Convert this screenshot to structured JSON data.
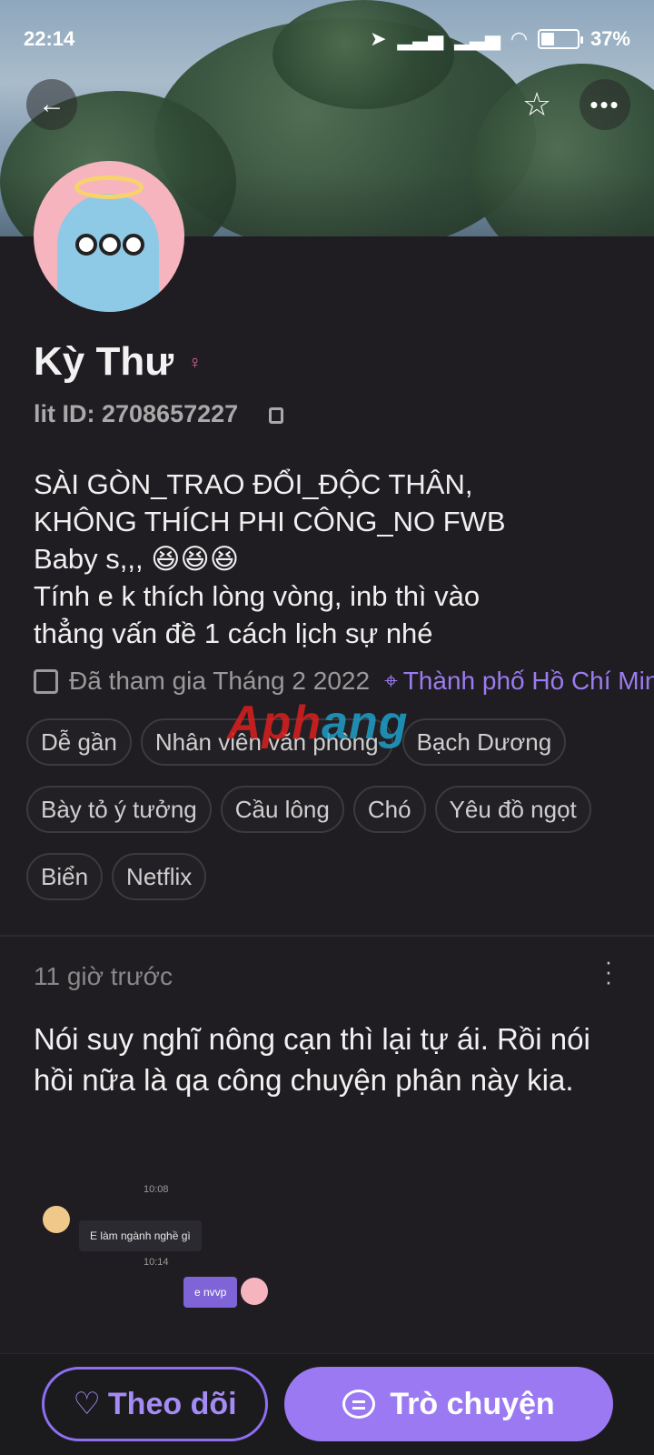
{
  "status_bar": {
    "time": "22:14",
    "battery": "37%"
  },
  "profile": {
    "name": "Kỳ Thư",
    "lit_id": "lit ID: 2708657227",
    "bio": [
      "SÀI GÒN_TRAO ĐỔI_ĐỘC THÂN,",
      "KHÔNG THÍCH PHI CÔNG_NO FWB",
      "Baby s,,, 😆😆😆",
      "Tính e k thích lòng vòng, inb thì vào",
      "thẳng vấn đề 1 cách lịch sự nhé"
    ],
    "joined": "Đã tham gia Tháng 2 2022",
    "location": "Thành phố Hồ Chí Minh",
    "tags": [
      "Dễ gần",
      "Nhân viên văn phòng",
      "Bạch Dương",
      "Bày tỏ ý tưởng",
      "Cầu lông",
      "Chó",
      "Yêu đồ ngọt",
      "Biển",
      "Netflix"
    ]
  },
  "watermark": {
    "part1": "Aph",
    "part2": "ang"
  },
  "post": {
    "time": "11 giờ trước",
    "text": "Nói suy nghĩ nông cạn thì lại tự ái. Rồi nói hồi nữa là qa công chuyện phân này kia.",
    "chat": {
      "ts1": "10:08",
      "msg_in": "E làm ngành nghề gì",
      "ts2": "10:14",
      "msg_out": "e nvvp"
    }
  },
  "actions": {
    "follow": "Theo dõi",
    "chat": "Trò chuyện"
  },
  "colors": {
    "accent": "#9b79f2",
    "background": "#1f1d21"
  }
}
